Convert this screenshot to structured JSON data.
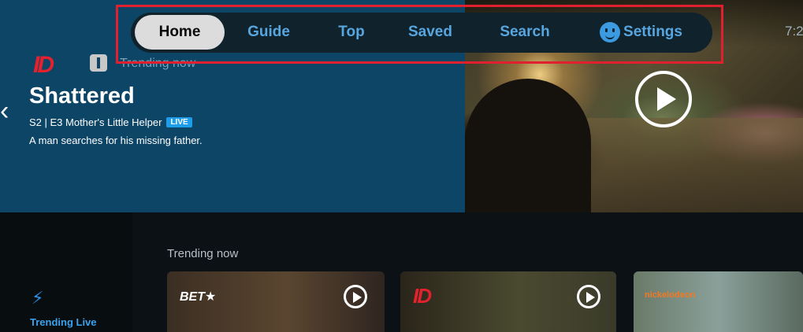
{
  "nav": {
    "home": "Home",
    "guide": "Guide",
    "top": "Top",
    "saved": "Saved",
    "search": "Search",
    "settings": "Settings"
  },
  "clock": "7:2",
  "hero": {
    "channel_logo": "ID",
    "kicker": "Trending now",
    "title": "Shattered",
    "episode": "S2 | E3 Mother's Little Helper",
    "live_badge": "LIVE",
    "description": "A man searches for his missing father."
  },
  "sidebar": {
    "label": "Trending Live"
  },
  "section": {
    "title": "Trending now"
  },
  "cards": [
    {
      "logo": "BET★"
    },
    {
      "logo": "ID"
    },
    {
      "logo": "nickelodeon"
    }
  ],
  "colors": {
    "accent": "#57a6df",
    "highlight": "#e0202e",
    "hero_bg": "#0c4566",
    "live": "#1e9ee8"
  }
}
